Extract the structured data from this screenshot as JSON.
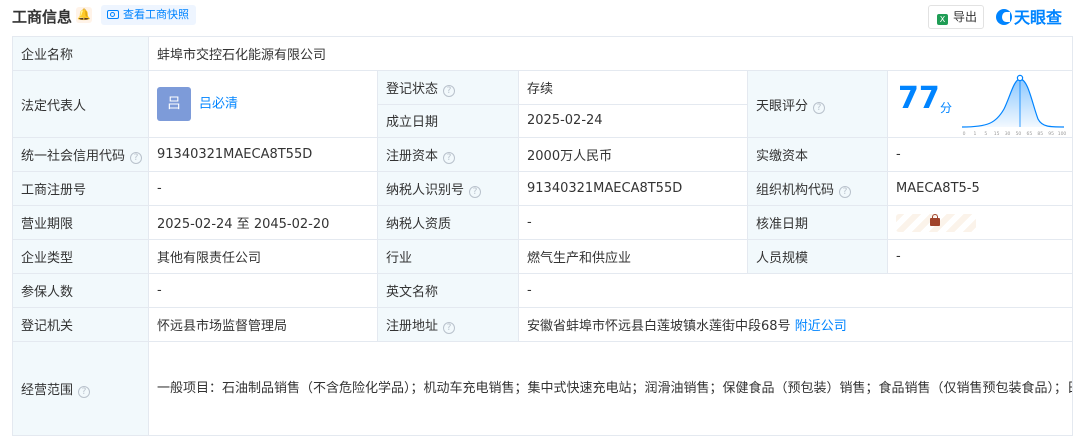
{
  "header": {
    "title": "工商信息",
    "snapshot_label": "查看工商快照",
    "export_label": "导出",
    "brand_name": "天眼查"
  },
  "fields": {
    "company_name_label": "企业名称",
    "company_name": "蚌埠市交控石化能源有限公司",
    "legal_rep_label": "法定代表人",
    "legal_rep_avatar": "吕",
    "legal_rep": "吕必清",
    "reg_status_label": "登记状态",
    "reg_status": "存续",
    "est_date_label": "成立日期",
    "est_date": "2025-02-24",
    "score_label": "天眼评分",
    "score": "77",
    "score_unit": "分",
    "credit_code_label": "统一社会信用代码",
    "credit_code": "91340321MAECA8T55D",
    "reg_capital_label": "注册资本",
    "reg_capital": "2000万人民币",
    "paid_capital_label": "实缴资本",
    "paid_capital": "-",
    "biz_reg_no_label": "工商注册号",
    "biz_reg_no": "-",
    "taxpayer_id_label": "纳税人识别号",
    "taxpayer_id": "91340321MAECA8T55D",
    "org_code_label": "组织机构代码",
    "org_code": "MAECA8T5-5",
    "term_label": "营业期限",
    "term": "2025-02-24 至 2045-02-20",
    "taxpayer_qual_label": "纳税人资质",
    "taxpayer_qual": "-",
    "approval_date_label": "核准日期",
    "company_type_label": "企业类型",
    "company_type": "其他有限责任公司",
    "industry_label": "行业",
    "industry": "燃气生产和供应业",
    "staff_size_label": "人员规模",
    "staff_size": "-",
    "insured_label": "参保人数",
    "insured": "-",
    "english_name_label": "英文名称",
    "english_name": "-",
    "reg_authority_label": "登记机关",
    "reg_authority": "怀远县市场监督管理局",
    "reg_address_label": "注册地址",
    "reg_address": "安徽省蚌埠市怀远县白莲坡镇水莲街中段68号",
    "nearby_label": "附近公司",
    "scope_label": "经营范围",
    "scope": "一般项目：石油制品销售（不含危险化学品）；机动车充电销售；集中式快速充电站；润滑油销售；保健食品（预包装）销售；食品销售（仅销售预包装食品）；日用百货销售；日用品销售；劳动保护用品销售；站用加氢及储氢设施销售；化肥销售；洗车服务；广告设计、代理；广告发布（除许可业务外，可自主依法经营法律法规非禁止或限制的项目）许可项目：燃气汽车加气经营；烟草制品零售；酒类经营；旅游业务；餐饮服务（依法须经批准的项目，经相关部门批准后方可开展经营活动，具体经营项目以相关部门批准文件或许可证件为准）"
  },
  "score_chart": {
    "ticks": [
      "0",
      "1",
      "5",
      "15",
      "30",
      "50",
      "65",
      "85",
      "95",
      "100"
    ],
    "accent": "#0084ff"
  }
}
